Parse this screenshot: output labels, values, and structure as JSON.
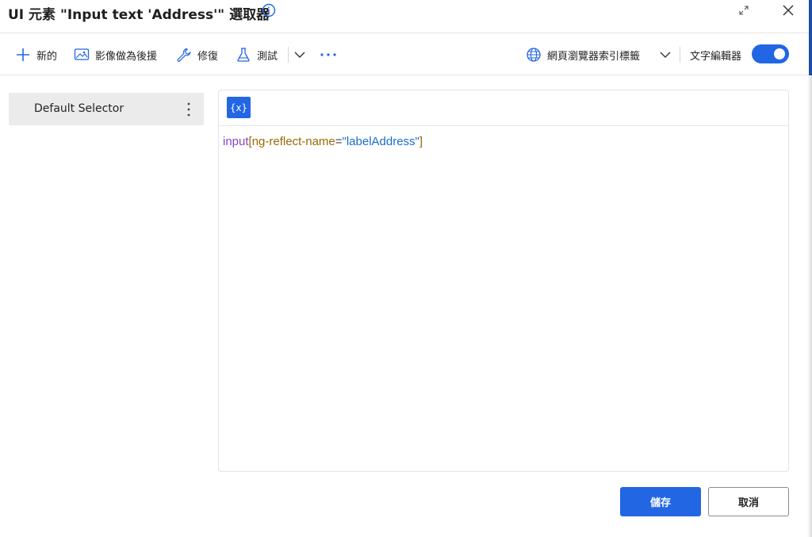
{
  "dialog": {
    "title": "UI 元素 \"Input text 'Address'\" 選取器"
  },
  "toolbar": {
    "new_label": "新的",
    "image_fallback_label": "影像做為後援",
    "repair_label": "修復",
    "test_label": "測試",
    "browser_tab_label": "網頁瀏覽器索引標籤",
    "text_editor_label": "文字編輯器",
    "text_editor_enabled": true
  },
  "selectors": {
    "items": [
      {
        "label": "Default Selector"
      }
    ]
  },
  "editor": {
    "var_button_label": "{x}",
    "code": {
      "tag": "input",
      "open_bracket": "[",
      "attr": "ng-reflect-name",
      "eq": "=",
      "value": "\"labelAddress\"",
      "close_bracket": "]"
    }
  },
  "footer": {
    "save_label": "儲存",
    "cancel_label": "取消"
  },
  "colors": {
    "accent": "#2266e3"
  }
}
